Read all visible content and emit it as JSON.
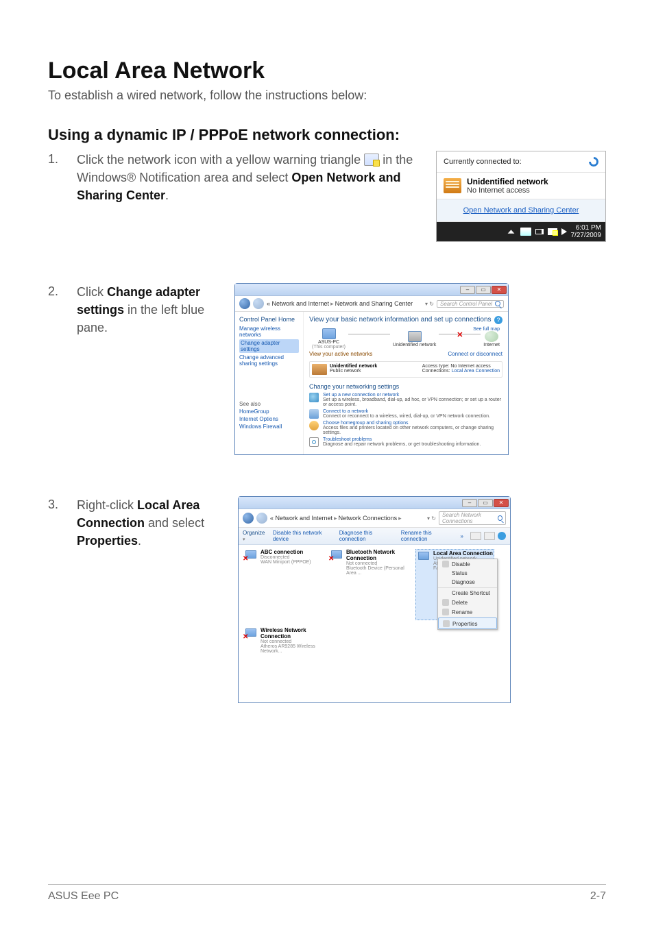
{
  "doc": {
    "title": "Local Area Network",
    "intro": "To establish a wired network, follow the instructions below:",
    "h2": "Using a dynamic IP / PPPoE network connection:"
  },
  "step1": {
    "num": "1.",
    "text_a": "Click the network icon with a yellow warning triangle ",
    "text_b": " in the Windows® Notification area and select ",
    "bold": "Open Network and Sharing Center",
    "period": "."
  },
  "step2": {
    "num": "2.",
    "text_a": "Click ",
    "bold": "Change adapter settings",
    "text_b": " in the left blue pane."
  },
  "step3": {
    "num": "3.",
    "text_a": "Right-click ",
    "bold1": "Local Area Connection",
    "text_b": " and select ",
    "bold2": "Properties",
    "period": "."
  },
  "popup": {
    "head": "Currently connected to:",
    "net_title": "Unidentified network",
    "net_sub": "No Internet access",
    "link": "Open Network and Sharing Center",
    "time": "6:01 PM",
    "date": "7/27/2009"
  },
  "win2": {
    "crumb1": "Network and Internet",
    "crumb2": "Network and Sharing Center",
    "search_ph": "Search Control Panel",
    "side_head": "Control Panel Home",
    "side_links": [
      "Manage wireless networks",
      "Change adapter settings",
      "Change advanced sharing settings"
    ],
    "see_also": "See also",
    "see_items": [
      "HomeGroup",
      "Internet Options",
      "Windows Firewall"
    ],
    "main_head": "View your basic network information and set up connections",
    "full_map": "See full map",
    "node_pc_name": "ASUS-PC",
    "node_pc_sub": "(This computer)",
    "node_mid": "Unidentified network",
    "node_net": "Internet",
    "active_head": "View your active networks",
    "active_right": "Connect or disconnect",
    "act_title": "Unidentified network",
    "act_sub": "Public network",
    "act_access_l": "Access type:",
    "act_access_v": "No Internet access",
    "act_conn_l": "Connections:",
    "act_conn_v": "Local Area Connection",
    "change_head": "Change your networking settings",
    "tasks": [
      {
        "t": "Set up a new connection or network",
        "d": "Set up a wireless, broadband, dial-up, ad hoc, or VPN connection; or set up a router or access point."
      },
      {
        "t": "Connect to a network",
        "d": "Connect or reconnect to a wireless, wired, dial-up, or VPN network connection."
      },
      {
        "t": "Choose homegroup and sharing options",
        "d": "Access files and printers located on other network computers, or change sharing settings."
      },
      {
        "t": "Troubleshoot problems",
        "d": "Diagnose and repair network problems, or get troubleshooting information."
      }
    ]
  },
  "win3": {
    "crumb1": "Network and Internet",
    "crumb2": "Network Connections",
    "search_ph": "Search Network Connections",
    "organize": "Organize",
    "tool_links": [
      "Disable this network device",
      "Diagnose this connection",
      "Rename this connection"
    ],
    "more": "»",
    "conns": [
      {
        "t": "ABC connection",
        "s": "Disconnected",
        "g": "WAN Miniport (PPPOE)"
      },
      {
        "t": "Bluetooth Network Connection",
        "s": "Not connected",
        "g": "Bluetooth Device (Personal Area ..."
      },
      {
        "t": "Local Area Connection",
        "s": "Unidentified network",
        "g": "Atheros AR8132 PCI-E Fast Ethern..."
      },
      {
        "t": "Wireless Network Connection",
        "s": "Not connected",
        "g": "Atheros AR9285 Wireless Network..."
      }
    ],
    "ctx": [
      "Disable",
      "Status",
      "Diagnose",
      "Create Shortcut",
      "Delete",
      "Rename",
      "Properties"
    ]
  },
  "footer": {
    "left": "ASUS Eee PC",
    "right": "2-7"
  }
}
